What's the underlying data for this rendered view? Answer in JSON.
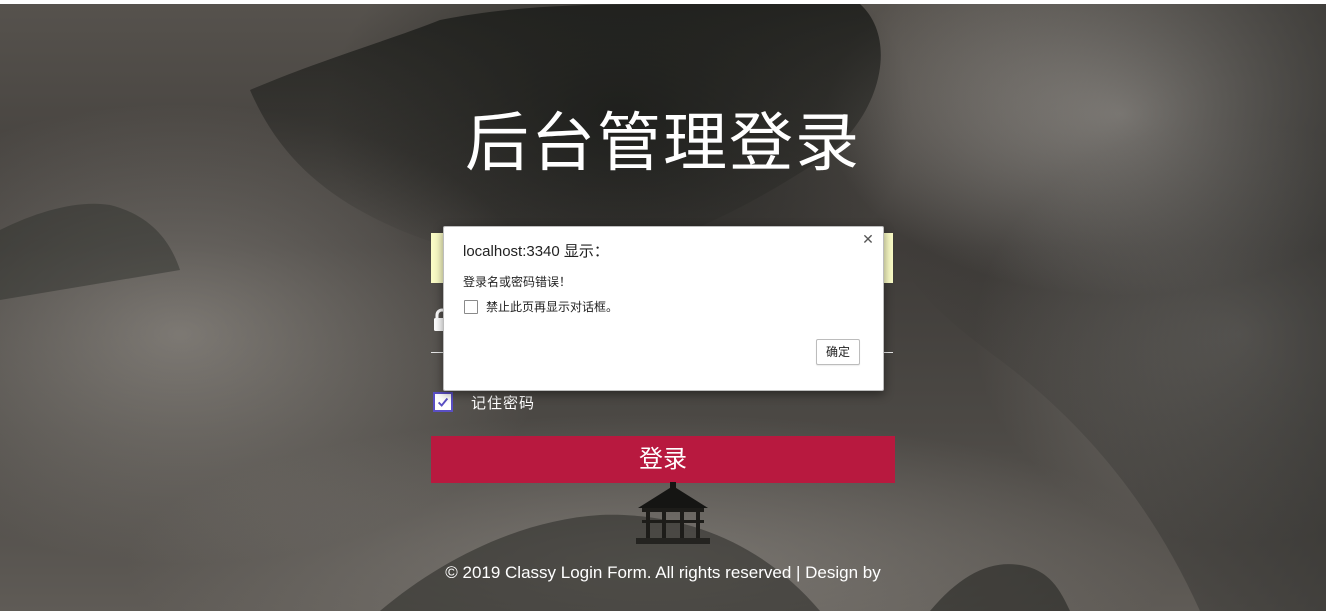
{
  "login_page": {
    "title": "后台管理登录",
    "username_value": "",
    "password_value": "",
    "remember_label": "记住密码",
    "remember_checked": true,
    "login_button_label": "登录",
    "footer_text": "© 2019 Classy Login Form. All rights reserved | Design by",
    "button_color": "#b8193f",
    "autofill_color": "#fbfcc6"
  },
  "dialog": {
    "title": "localhost:3340 显示：",
    "message": "登录名或密码错误！",
    "suppress_label": "禁止此页再显示对话框。",
    "suppress_checked": false,
    "ok_label": "确定",
    "close_icon": "close-icon"
  }
}
